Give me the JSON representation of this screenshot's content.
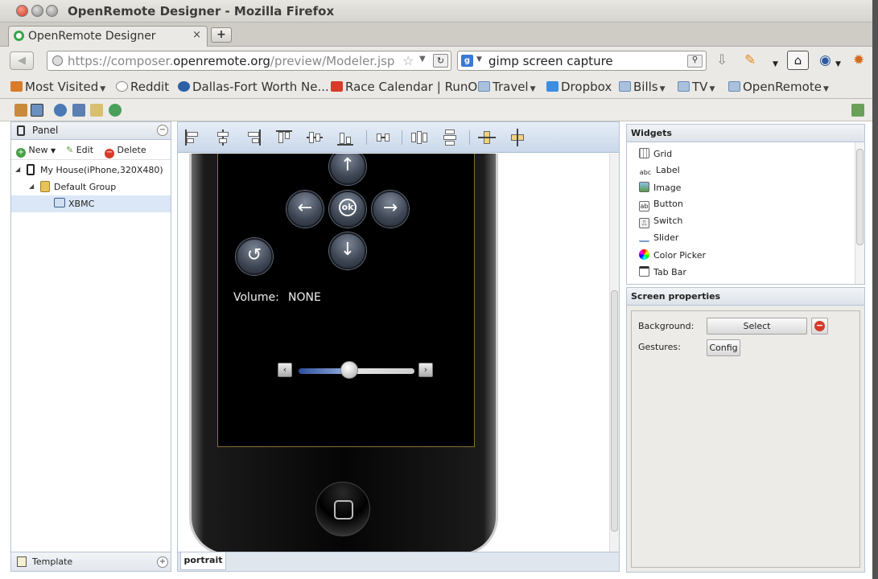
{
  "window": {
    "title": "OpenRemote Designer - Mozilla Firefox"
  },
  "tab": {
    "label": "OpenRemote Designer",
    "close": "×",
    "new_tab": "+"
  },
  "nav": {
    "url_prefix": "https://composer.",
    "url_domain": "openremote.org",
    "url_path": "/preview/Modeler.jsp",
    "search_engine": "g",
    "search_text": "gimp screen capture"
  },
  "bookmarks": [
    {
      "label": "Most Visited",
      "dropdown": true
    },
    {
      "label": "Reddit",
      "dropdown": false
    },
    {
      "label": "Dallas-Fort Worth Ne...",
      "dropdown": false
    },
    {
      "label": "Race Calendar | RunOn!",
      "dropdown": false
    },
    {
      "label": "Travel",
      "dropdown": true
    },
    {
      "label": "Dropbox",
      "dropdown": false
    },
    {
      "label": "Bills",
      "dropdown": true
    },
    {
      "label": "TV",
      "dropdown": true
    },
    {
      "label": "OpenRemote",
      "dropdown": true
    }
  ],
  "left_panel": {
    "title": "Panel",
    "tools": {
      "new": "New",
      "edit": "Edit",
      "delete": "Delete"
    },
    "tree": [
      {
        "label": "My House(iPhone,320X480)"
      },
      {
        "label": "Default Group"
      },
      {
        "label": "XBMC"
      }
    ],
    "footer": "Template"
  },
  "canvas": {
    "tab": "portrait",
    "screen": {
      "ok_label": "ok",
      "volume_label": "Volume:",
      "volume_value": "NONE"
    }
  },
  "widgets": {
    "title": "Widgets",
    "items": [
      {
        "label": "Grid",
        "icon": "grid-icon"
      },
      {
        "label": "Label",
        "icon": "abc-label-icon"
      },
      {
        "label": "Image",
        "icon": "image-icon"
      },
      {
        "label": "Button",
        "icon": "ab-button-icon"
      },
      {
        "label": "Switch",
        "icon": "switch-icon"
      },
      {
        "label": "Slider",
        "icon": "slider-icon"
      },
      {
        "label": "Color Picker",
        "icon": "color-wheel-icon"
      },
      {
        "label": "Tab Bar",
        "icon": "tabbar-icon"
      }
    ]
  },
  "screen_properties": {
    "title": "Screen properties",
    "background_label": "Background:",
    "select_button": "Select",
    "gestures_label": "Gestures:",
    "config_button": "Config"
  },
  "colors": {
    "accent_blue": "#3a77d6",
    "panel_border": "#b6c4d6",
    "delete_red": "#d53a2a"
  }
}
